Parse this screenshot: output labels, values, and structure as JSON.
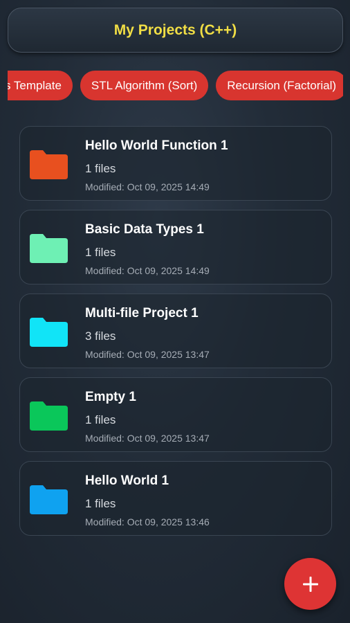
{
  "header": {
    "title": "My Projects (C++)"
  },
  "chips": [
    {
      "label": "Class Template"
    },
    {
      "label": "STL Algorithm (Sort)"
    },
    {
      "label": "Recursion (Factorial)"
    }
  ],
  "projects": [
    {
      "name": "Hello World Function 1",
      "files": "1 files",
      "modified": "Modified: Oct 09, 2025 14:49",
      "icon": "folder-icon",
      "color": "#e8501f"
    },
    {
      "name": "Basic Data Types 1",
      "files": "1 files",
      "modified": "Modified: Oct 09, 2025 14:49",
      "icon": "folder-icon",
      "color": "#6ef0b4"
    },
    {
      "name": "Multi-file Project 1",
      "files": "3 files",
      "modified": "Modified: Oct 09, 2025 13:47",
      "icon": "folder-icon",
      "color": "#11e4f7"
    },
    {
      "name": "Empty 1",
      "files": "1 files",
      "modified": "Modified: Oct 09, 2025 13:47",
      "icon": "folder-icon",
      "color": "#0ac75a"
    },
    {
      "name": "Hello World 1",
      "files": "1 files",
      "modified": "Modified: Oct 09, 2025 13:46",
      "icon": "folder-icon",
      "color": "#0fa2f0"
    }
  ],
  "fab": {
    "icon": "plus-icon",
    "color": "#de3434"
  }
}
